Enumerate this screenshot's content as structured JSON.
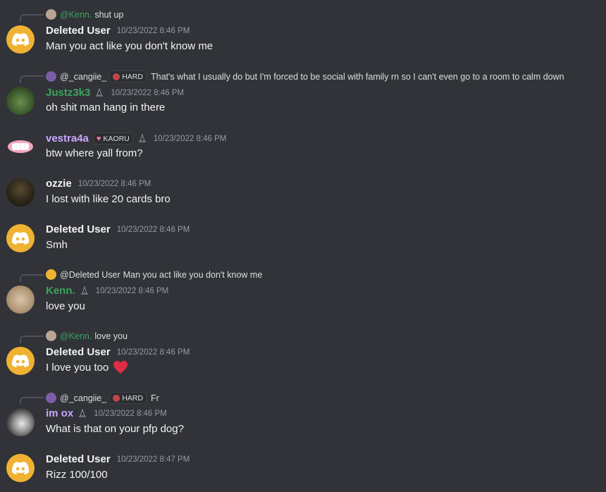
{
  "messages": [
    {
      "reply": {
        "mention": "@Kenn.",
        "text": "shut up",
        "mention_color": "#3ba55d"
      },
      "username": "Deleted User",
      "username_color": "#f2f3f5",
      "timestamp": "10/23/2022 8:46 PM",
      "text": "Man you act like you don't know me"
    },
    {
      "reply": {
        "mention": "@_cangiie_",
        "badge": "HARD",
        "text": "That's what I usually do but I'm forced to be social with family rn so I can't even go to a room to calm down",
        "mention_color": "#dbdee1"
      },
      "username": "Justz3k3",
      "username_color": "#3ba55d",
      "timestamp": "10/23/2022 8:46 PM",
      "text": "oh shit man hang in there"
    },
    {
      "username": "vestra4a",
      "username_color": "#c9a6ff",
      "tag": "KAORU",
      "timestamp": "10/23/2022 8:46 PM",
      "text": "btw where yall from?"
    },
    {
      "username": "ozzie",
      "username_color": "#f2f3f5",
      "timestamp": "10/23/2022 8:46 PM",
      "text": "I lost with like 20 cards bro"
    },
    {
      "username": "Deleted User",
      "username_color": "#f2f3f5",
      "timestamp": "10/23/2022 8:46 PM",
      "text": "Smh"
    },
    {
      "reply": {
        "mention": "@Deleted User",
        "text": "Man you act like you don't know me",
        "mention_color": "#dbdee1"
      },
      "username": "Kenn.",
      "username_color": "#3ba55d",
      "timestamp": "10/23/2022 8:46 PM",
      "text": "love you"
    },
    {
      "reply": {
        "mention": "@Kenn.",
        "text": "love you",
        "mention_color": "#3ba55d"
      },
      "username": "Deleted User",
      "username_color": "#f2f3f5",
      "timestamp": "10/23/2022 8:46 PM",
      "text": "I love you too"
    },
    {
      "reply": {
        "mention": "@_cangiie_",
        "badge": "HARD",
        "text": "Fr",
        "mention_color": "#dbdee1"
      },
      "username": "im ox",
      "username_color": "#c9a6ff",
      "timestamp": "10/23/2022 8:46 PM",
      "text": "What is that on your pfp dog?"
    },
    {
      "username": "Deleted User",
      "username_color": "#f2f3f5",
      "timestamp": "10/23/2022 8:47 PM",
      "text": "Rizz 100/100"
    }
  ]
}
